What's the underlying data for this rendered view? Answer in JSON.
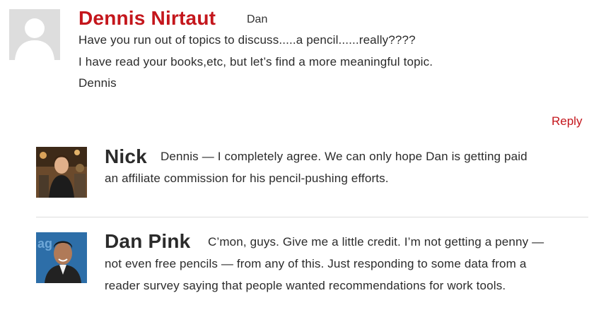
{
  "comments": [
    {
      "author": "Dennis Nirtaut",
      "addressed_to": "Dan",
      "avatar": "default-avatar-silhouette",
      "lines": [
        "Have you run out of topics to discuss.....a pencil......really????",
        "I have read your books,etc, but let’s find a more meaningful topic.",
        "Dennis"
      ],
      "reply_label": "Reply"
    },
    {
      "author": "Nick",
      "avatar": "photo-person-nick",
      "lines": [
        "Dennis — I completely agree. We can only hope Dan is getting paid",
        "an affiliate commission for his pencil-pushing efforts."
      ]
    },
    {
      "author": "Dan Pink",
      "avatar": "photo-person-dan-pink",
      "lines": [
        "C’mon, guys. Give me a little credit. I’m not getting a penny —",
        "not even free pencils — from any of this. Just responding to some data from a",
        "reader survey saying that people wanted recommendations for work tools."
      ]
    }
  ],
  "colors": {
    "accent_red": "#c4161c",
    "text": "#2b2b2b",
    "divider": "#dcdcdc",
    "avatar_bg": "#dddddd"
  }
}
